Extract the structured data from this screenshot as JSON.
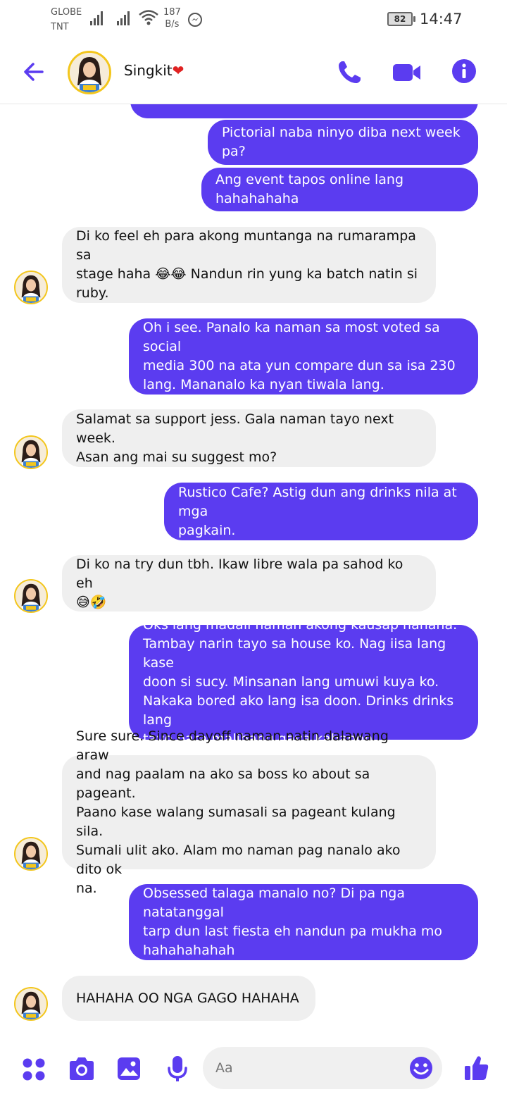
{
  "status_bar": {
    "carrier_1": "GLOBE",
    "carrier_2": "TNT",
    "speed_value": "187",
    "speed_unit": "B/s",
    "battery": "82",
    "time": "14:47"
  },
  "header": {
    "contact_name": "Singkit",
    "name_emoji": "❤",
    "icons": [
      "back-arrow-icon",
      "phone-icon",
      "video-icon",
      "info-icon"
    ],
    "accent_color": "#5b3cf0"
  },
  "messages": [
    {
      "dir": "out",
      "text": "Pictorial naba ninyo diba next week pa?"
    },
    {
      "dir": "out",
      "text": "Ang event tapos online lang hahahahaha"
    },
    {
      "dir": "in",
      "text": "Di ko feel eh para akong muntanga na rumarampa sa\nstage haha 😂😂 Nandun rin yung ka batch natin si\nruby."
    },
    {
      "dir": "out",
      "text": "Oh i see. Panalo ka naman sa most voted sa social\nmedia 300 na ata yun compare dun sa isa 230\nlang. Mananalo ka nyan tiwala lang."
    },
    {
      "dir": "in",
      "text": "Salamat sa support jess. Gala naman tayo next week.\nAsan ang mai su suggest mo?"
    },
    {
      "dir": "out",
      "text": "Rustico Cafe? Astig dun ang drinks nila at mga\npagkain."
    },
    {
      "dir": "in",
      "text": "Di ko na try dun tbh. Ikaw libre wala pa sahod ko eh\n😅🤣"
    },
    {
      "dir": "out",
      "text": "Oks lang madali naman akong kausap hahaha.\nTambay narin tayo sa house ko. Nag iisa lang kase\ndoon si sucy. Minsanan lang umuwi kuya ko.\nNakaka bored ako lang isa doon. Drinks drinks lang\ntayo para malibang gaya kahapon."
    },
    {
      "dir": "in",
      "text": "Sure sure. Since dayoff naman natin dalawang araw\nand nag paalam na ako sa boss ko about sa pageant.\nPaano kase walang sumasali sa pageant  kulang sila.\nSumali ulit ako. Alam mo naman pag nanalo ako dito ok\nna."
    },
    {
      "dir": "out",
      "text": "Obsessed talaga manalo no? Di pa nga natatanggal\ntarp dun last fiesta eh nandun pa mukha mo\nhahahahahah"
    },
    {
      "dir": "in",
      "text": "HAHAHA OO NGA GAGO HAHAHA"
    }
  ],
  "composer": {
    "placeholder": "Aa",
    "icons": [
      "menu-dots-icon",
      "camera-icon",
      "gallery-icon",
      "microphone-icon",
      "emoji-icon",
      "thumbs-up-icon"
    ]
  }
}
